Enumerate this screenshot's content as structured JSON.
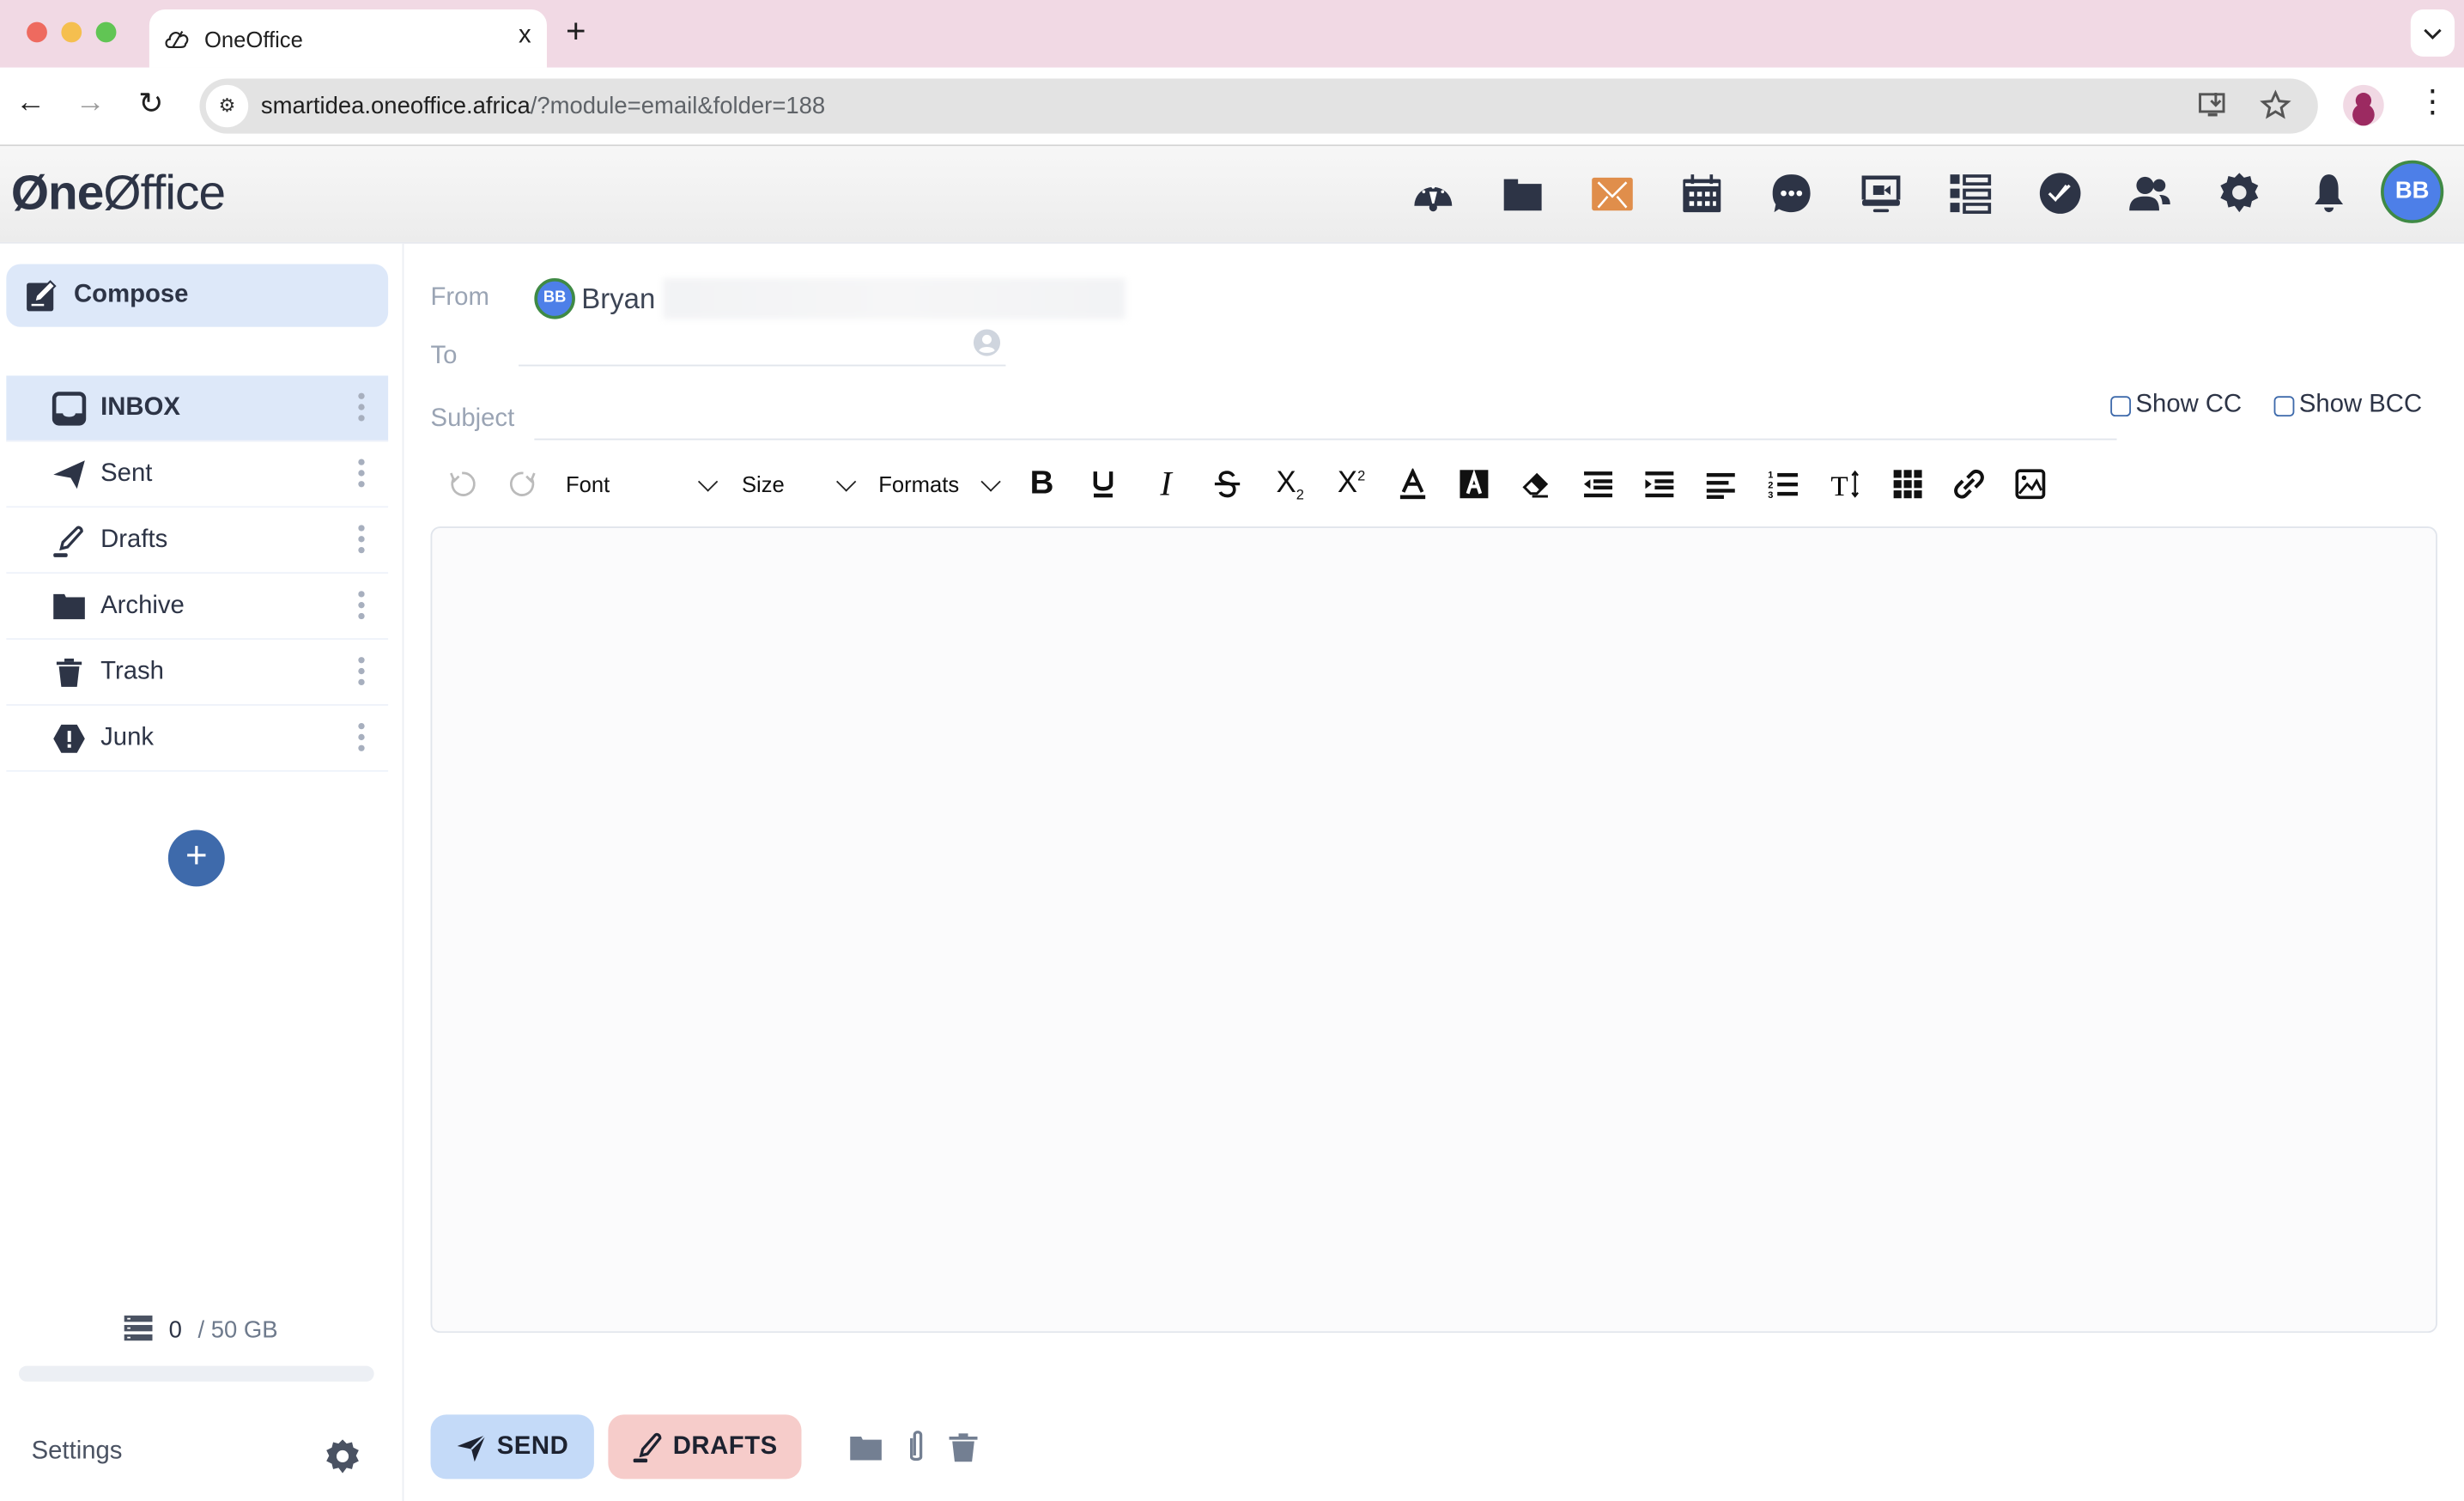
{
  "browser": {
    "tab_title": "OneOffice",
    "tab_close": "x",
    "new_tab": "+",
    "tab_menu": "⌄",
    "url_host": "smartidea.oneoffice.africa",
    "url_path": "/?module=email&folder=188",
    "nav": {
      "back": "←",
      "forward": "→",
      "reload": "↻"
    },
    "menu": "⋮"
  },
  "app": {
    "logo_bold": "Øne",
    "logo_light": "Øffice",
    "header_icons": [
      "dashboard-icon",
      "files-icon",
      "email-icon",
      "calendar-icon",
      "chat-icon",
      "video-meeting-icon",
      "list-icon",
      "tasks-icon",
      "contacts-icon",
      "settings-icon",
      "notifications-icon"
    ],
    "active_icon": "email-icon",
    "accent_active": "#e08e4b",
    "user_initials": "BB",
    "avatar_color": "#4d7fe8"
  },
  "sidebar": {
    "compose_label": "Compose",
    "folders": [
      {
        "name": "INBOX",
        "icon": "inbox-icon",
        "active": true
      },
      {
        "name": "Sent",
        "icon": "paper-plane-icon",
        "active": false
      },
      {
        "name": "Drafts",
        "icon": "pencil-icon",
        "active": false
      },
      {
        "name": "Archive",
        "icon": "folder-icon",
        "active": false
      },
      {
        "name": "Trash",
        "icon": "trash-icon",
        "active": false
      },
      {
        "name": "Junk",
        "icon": "warning-icon",
        "active": false
      }
    ],
    "add_folder": "+",
    "storage": {
      "used": "0",
      "separator": "/",
      "total": "50 GB",
      "used_fraction": 0
    },
    "settings_label": "Settings"
  },
  "compose": {
    "from_label": "From",
    "from_initials": "BB",
    "from_name": "Bryan",
    "to_label": "To",
    "to_value": "",
    "subject_label": "Subject",
    "subject_value": "",
    "show_cc": {
      "label": "Show CC",
      "checked": false
    },
    "show_bcc": {
      "label": "Show BCC",
      "checked": false
    },
    "toolbar": {
      "font": "Font",
      "size": "Size",
      "formats": "Formats",
      "buttons": [
        "undo",
        "redo",
        "bold",
        "underline",
        "italic",
        "strikethrough",
        "subscript",
        "superscript",
        "text-color",
        "background-color",
        "clear-formatting",
        "outdent",
        "indent",
        "align-left",
        "numbered-list",
        "line-height",
        "table",
        "link",
        "image"
      ]
    },
    "body": "",
    "send_label": "SEND",
    "drafts_label": "DRAFTS"
  }
}
